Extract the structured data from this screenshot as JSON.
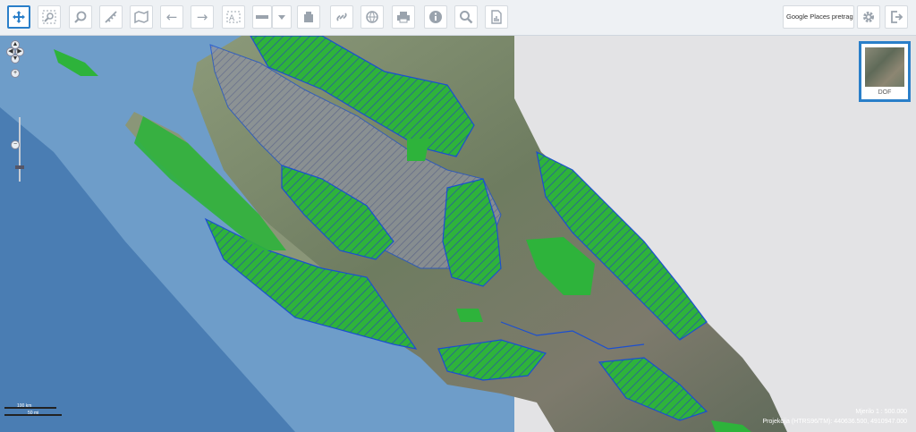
{
  "toolbar": {
    "tools": [
      {
        "name": "pan",
        "icon": "pan-move-icon"
      },
      {
        "name": "zoom-box",
        "icon": "zoom-box-icon"
      },
      {
        "name": "identify",
        "icon": "identify-icon"
      },
      {
        "name": "measure",
        "icon": "measure-icon"
      },
      {
        "name": "layers",
        "icon": "layers-map-icon"
      },
      {
        "name": "back",
        "icon": "arrow-left-icon"
      },
      {
        "name": "forward",
        "icon": "arrow-right-icon"
      },
      {
        "name": "text",
        "icon": "text-annotation-icon"
      },
      {
        "name": "draw",
        "icon": "draw-line-icon"
      },
      {
        "name": "erase",
        "icon": "eraser-icon"
      },
      {
        "name": "link",
        "icon": "link-icon"
      },
      {
        "name": "web",
        "icon": "globe-icon"
      },
      {
        "name": "print",
        "icon": "printer-icon"
      },
      {
        "name": "info",
        "icon": "info-icon"
      },
      {
        "name": "search",
        "icon": "search-icon"
      },
      {
        "name": "report",
        "icon": "report-chart-icon"
      }
    ],
    "places_search_label": "Google Places pretraga",
    "settings_icon": "gear-icon",
    "logout_icon": "logout-icon"
  },
  "basemap": {
    "label": "DOF"
  },
  "scale_bar": {
    "upper": "100 km",
    "lower": "50 mi"
  },
  "map_info": {
    "scale": "Mjerilo 1 : 500.000",
    "projection": "Projekcija (HTRS96/TM): 440636.500, 4910947.000"
  },
  "colors": {
    "sea_light": "#6e9dc9",
    "sea_deep": "#4a7db3",
    "protected_area": "#2eb33b",
    "boundary": "#1b4fd1",
    "land": "#7c8b6c"
  }
}
